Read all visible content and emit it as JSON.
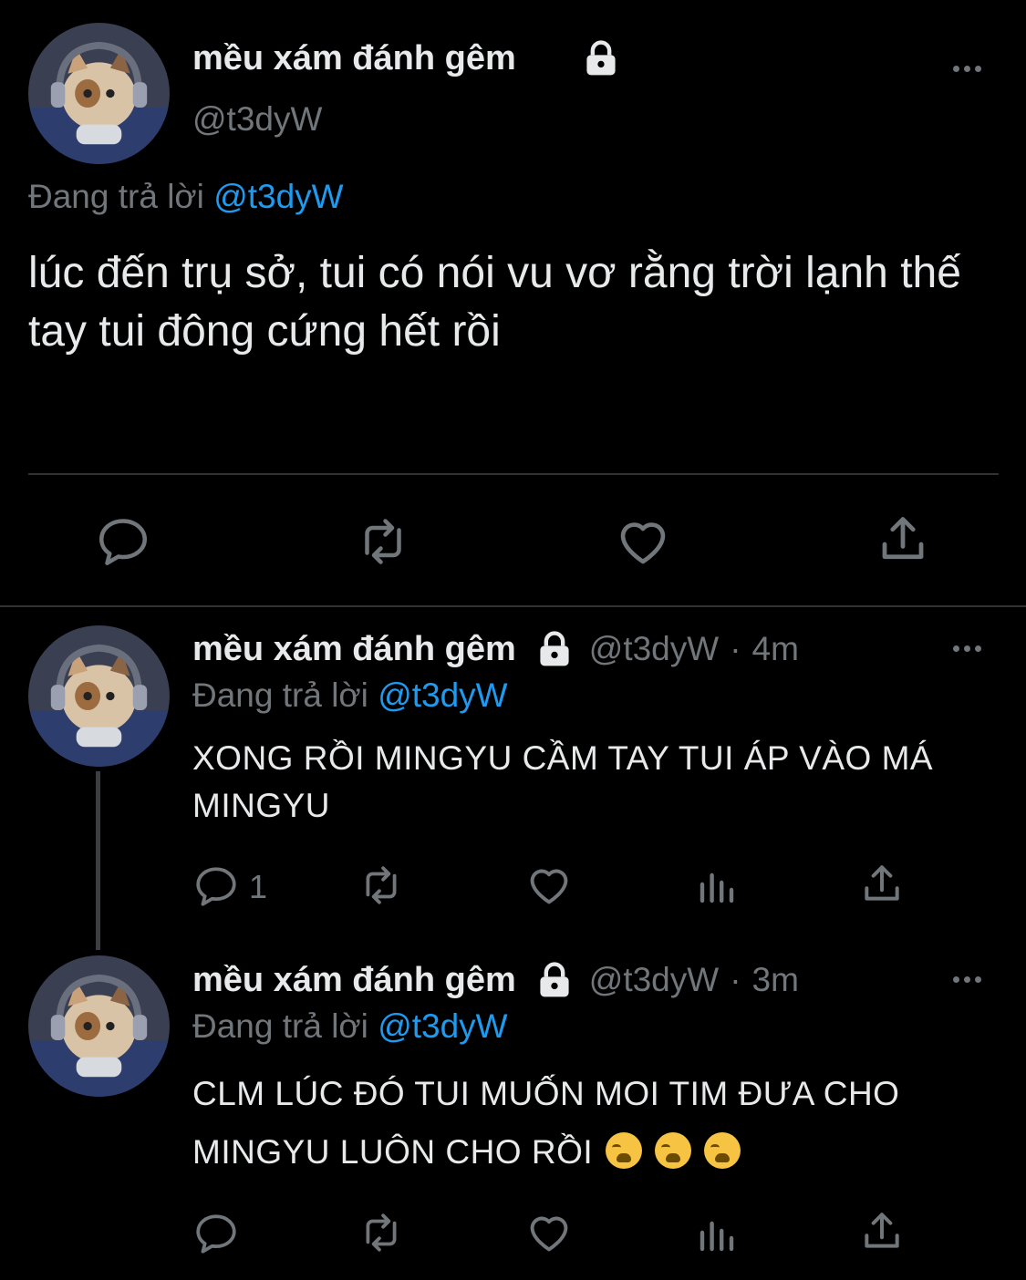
{
  "main_tweet": {
    "display_name": "mều xám đánh gêm",
    "handle": "@t3dyW",
    "replying_label": "Đang trả lời",
    "replying_to": "@t3dyW",
    "text": "lúc đến trụ sở, tui có nói vu vơ rằng trời lạnh thế tay tui đông cứng hết rồi",
    "icons": [
      "lock-icon",
      "more-icon",
      "reply-icon",
      "retweet-icon",
      "like-icon",
      "share-icon"
    ]
  },
  "replies": [
    {
      "display_name": "mều xám đánh gêm",
      "handle": "@t3dyW",
      "separator": "·",
      "time": "4m",
      "replying_label": "Đang trả lời",
      "replying_to": "@t3dyW",
      "text": "XONG RỒI MINGYU CẦM TAY TUI ÁP VÀO MÁ MINGYU",
      "reply_count": "1"
    },
    {
      "display_name": "mều xám đánh gêm",
      "handle": "@t3dyW",
      "separator": "·",
      "time": "3m",
      "replying_label": "Đang trả lời",
      "replying_to": "@t3dyW",
      "text": "CLM LÚC ĐÓ TUI MUỐN MOI TIM ĐƯA CHO MINGYU LUÔN CHO RỒI",
      "emoji": [
        "😭",
        "😭",
        "😭"
      ],
      "reply_count": ""
    }
  ],
  "colors": {
    "background": "#000000",
    "text": "#e7e9ea",
    "muted": "#71767b",
    "link": "#1d9bf0"
  }
}
